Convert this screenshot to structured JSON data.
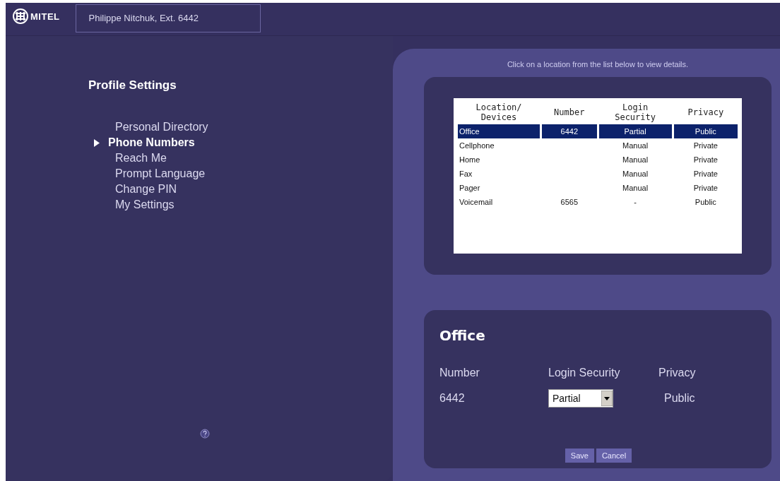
{
  "header": {
    "logo_text": "MITEL",
    "user": "Philippe Nitchuk, Ext. 6442"
  },
  "sidebar": {
    "title": "Profile Settings",
    "items": [
      {
        "label": "Personal Directory",
        "selected": false
      },
      {
        "label": "Phone Numbers",
        "selected": true
      },
      {
        "label": "Reach Me",
        "selected": false
      },
      {
        "label": "Prompt Language",
        "selected": false
      },
      {
        "label": "Change PIN",
        "selected": false
      },
      {
        "label": "My Settings",
        "selected": false
      }
    ]
  },
  "locations": {
    "hint": "Click on a location from the list below to view details.",
    "columns": [
      "Location/ Devices",
      "Number",
      "Login Security",
      "Privacy"
    ],
    "rows": [
      {
        "cells": [
          "Office",
          "6442",
          "Partial",
          "Public"
        ],
        "selected": true
      },
      {
        "cells": [
          "Cellphone",
          "",
          "Manual",
          "Private"
        ],
        "selected": false
      },
      {
        "cells": [
          "Home",
          "",
          "Manual",
          "Private"
        ],
        "selected": false
      },
      {
        "cells": [
          "Fax",
          "",
          "Manual",
          "Private"
        ],
        "selected": false
      },
      {
        "cells": [
          "Pager",
          "",
          "Manual",
          "Private"
        ],
        "selected": false
      },
      {
        "cells": [
          "Voicemail",
          "6565",
          "-",
          "Public"
        ],
        "selected": false
      }
    ]
  },
  "details": {
    "title": "Office",
    "labels": [
      "Number",
      "Login Security",
      "Privacy"
    ],
    "number": "6442",
    "login_security": "Partial",
    "privacy": "Public",
    "buttons": [
      "Save",
      "Cancel"
    ]
  }
}
